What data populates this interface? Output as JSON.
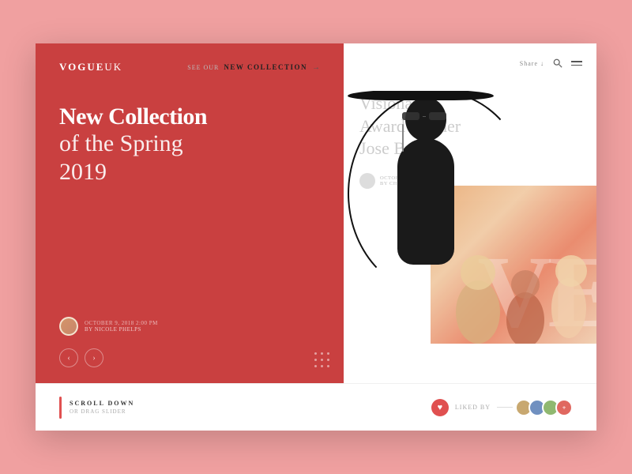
{
  "page": {
    "background_color": "#f0a0a0"
  },
  "logo": {
    "vogue": "VOGUE",
    "uk": "UK"
  },
  "top_nav": {
    "see_our": "SEE OUR",
    "new_collection": "NEW COLLECTION",
    "arrow": "→",
    "share": "Share",
    "share_arrow": "↓"
  },
  "hero": {
    "heading_bold": "New Collection",
    "heading_sub1": "of the Spring",
    "heading_year": "2019",
    "author_date": "OCTOBER 9, 2018 2:00 PM",
    "author_name": "BY NICOLE PHELPS",
    "secondary_title_line1": "Visionary",
    "secondary_title_line2": "Award Winner",
    "secondary_title_line3": "Jose Bedia",
    "secondary_date": "OCTOBER 9, 2018 4:30 PM",
    "secondary_author": "BY CHLOE DORANS"
  },
  "nav_arrows": {
    "left": "‹",
    "right": "›"
  },
  "bottom_bar": {
    "scroll_label": "SCROLL DOWN",
    "scroll_sub": "OR DRAG SLIDER",
    "liked_by": "LIKED BY"
  },
  "vogue_bg": "VE"
}
